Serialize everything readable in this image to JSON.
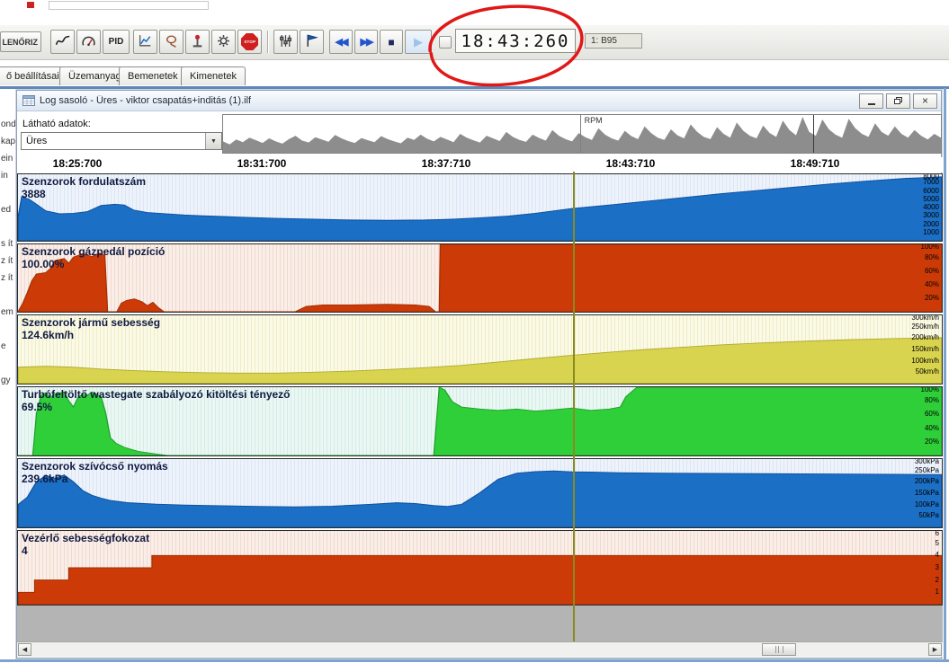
{
  "topbar": {
    "check_button": "LENŐRIZ",
    "pid_button": "PID",
    "stop_sign_label": "STOP",
    "time_display": "18:43:260",
    "channel_badge": "1: B95"
  },
  "icons": {
    "close": "×",
    "dropdown_arrow": "▼",
    "scroll_left": "◀",
    "scroll_right": "▶",
    "rewind": "◀◀",
    "fast_forward": "▶▶",
    "stop": "■",
    "play": "▶"
  },
  "tabs": [
    "ő beállításai",
    "Üzemanyag",
    "Bemenetek",
    "Kimenetek"
  ],
  "sidebar_fragments": [
    "ond",
    "kap",
    "ein",
    "in",
    "ed",
    "s ít",
    "z ít",
    "z ít",
    "em",
    "e",
    "gy"
  ],
  "window": {
    "title": "Log sasoló - Üres - viktor csapatás+inditás (1).ilf",
    "visible_data_label": "Látható adatok:",
    "visible_data_value": "Üres",
    "overview_channel": "RPM"
  },
  "timeline": [
    "18:25:700",
    "18:31:700",
    "18:37:710",
    "18:43:710",
    "18:49:710"
  ],
  "cursor": {
    "x_fraction": 0.602
  },
  "overview": {
    "divider_fraction": 0.497,
    "cursor_fraction": 0.822
  },
  "chart_data": [
    {
      "type": "area",
      "title": "Szenzorok fordulatszám",
      "value_label": "3888",
      "color": "#1b6fc4",
      "edge": "#0d4f9e",
      "ylim": [
        0,
        8000
      ],
      "ticks": [
        "8000",
        "7000",
        "6000",
        "5000",
        "4000",
        "3000",
        "2000",
        "1000"
      ],
      "points": [
        [
          0,
          2800
        ],
        [
          0.004,
          5300
        ],
        [
          0.012,
          5000
        ],
        [
          0.02,
          4400
        ],
        [
          0.03,
          3600
        ],
        [
          0.045,
          3250
        ],
        [
          0.06,
          3300
        ],
        [
          0.075,
          3500
        ],
        [
          0.09,
          4250
        ],
        [
          0.105,
          4400
        ],
        [
          0.115,
          4300
        ],
        [
          0.125,
          3700
        ],
        [
          0.14,
          3400
        ],
        [
          0.16,
          3250
        ],
        [
          0.18,
          3100
        ],
        [
          0.2,
          3000
        ],
        [
          0.24,
          2850
        ],
        [
          0.28,
          2700
        ],
        [
          0.32,
          2600
        ],
        [
          0.36,
          2500
        ],
        [
          0.4,
          2460
        ],
        [
          0.44,
          2500
        ],
        [
          0.46,
          2560
        ],
        [
          0.48,
          2650
        ],
        [
          0.5,
          2760
        ],
        [
          0.53,
          2960
        ],
        [
          0.56,
          3300
        ],
        [
          0.6,
          3888
        ],
        [
          0.64,
          4300
        ],
        [
          0.68,
          4750
        ],
        [
          0.72,
          5200
        ],
        [
          0.76,
          5650
        ],
        [
          0.8,
          6050
        ],
        [
          0.84,
          6450
        ],
        [
          0.88,
          6850
        ],
        [
          0.92,
          7200
        ],
        [
          0.96,
          7500
        ],
        [
          1,
          7700
        ]
      ]
    },
    {
      "type": "area",
      "title": "Szenzorok gázpedál pozíció",
      "value_label": "100.00%",
      "color": "#cc3b07",
      "edge": "#a32f04",
      "ylim": [
        0,
        100
      ],
      "ticks": [
        "100%",
        "80%",
        "60%",
        "40%",
        "20%"
      ],
      "points": [
        [
          0,
          0
        ],
        [
          0.005,
          12
        ],
        [
          0.01,
          28
        ],
        [
          0.015,
          46
        ],
        [
          0.02,
          56
        ],
        [
          0.03,
          58
        ],
        [
          0.035,
          64
        ],
        [
          0.04,
          76
        ],
        [
          0.05,
          79
        ],
        [
          0.055,
          72
        ],
        [
          0.06,
          81
        ],
        [
          0.07,
          86
        ],
        [
          0.08,
          82
        ],
        [
          0.088,
          87
        ],
        [
          0.094,
          84
        ],
        [
          0.097,
          0
        ],
        [
          0.107,
          0
        ],
        [
          0.112,
          13
        ],
        [
          0.118,
          17
        ],
        [
          0.126,
          19
        ],
        [
          0.134,
          15
        ],
        [
          0.14,
          9
        ],
        [
          0.146,
          14
        ],
        [
          0.152,
          6
        ],
        [
          0.158,
          0
        ],
        [
          0.3,
          0
        ],
        [
          0.312,
          8
        ],
        [
          0.33,
          10
        ],
        [
          0.36,
          10
        ],
        [
          0.4,
          11
        ],
        [
          0.43,
          10
        ],
        [
          0.445,
          8
        ],
        [
          0.452,
          0
        ],
        [
          0.456,
          0
        ],
        [
          0.457,
          100
        ],
        [
          1,
          100
        ]
      ]
    },
    {
      "type": "area",
      "title": "Szenzorok jármű sebesség",
      "value_label": "124.6km/h",
      "color": "#d9d44f",
      "edge": "#b0aa30",
      "ylim": [
        0,
        300
      ],
      "ticks": [
        "300km/h",
        "250km/h",
        "200km/h",
        "150km/h",
        "100km/h",
        "50km/h"
      ],
      "points": [
        [
          0,
          72
        ],
        [
          0.03,
          76
        ],
        [
          0.06,
          72
        ],
        [
          0.09,
          64
        ],
        [
          0.12,
          58
        ],
        [
          0.16,
          52
        ],
        [
          0.2,
          48
        ],
        [
          0.24,
          46
        ],
        [
          0.28,
          46
        ],
        [
          0.32,
          50
        ],
        [
          0.36,
          55
        ],
        [
          0.4,
          62
        ],
        [
          0.44,
          70
        ],
        [
          0.48,
          80
        ],
        [
          0.52,
          95
        ],
        [
          0.56,
          110
        ],
        [
          0.6,
          124.6
        ],
        [
          0.64,
          138
        ],
        [
          0.68,
          150
        ],
        [
          0.72,
          160
        ],
        [
          0.76,
          170
        ],
        [
          0.8,
          178
        ],
        [
          0.85,
          186
        ],
        [
          0.9,
          193
        ],
        [
          0.95,
          198
        ],
        [
          1,
          202
        ]
      ]
    },
    {
      "type": "area",
      "title": "Turbófeltöltő wastegate szabályozó kitöltési tényező",
      "value_label": "69.5%",
      "color": "#2fcf39",
      "edge": "#1e9e28",
      "ylim": [
        0,
        100
      ],
      "ticks": [
        "100%",
        "80%",
        "60%",
        "40%",
        "20%"
      ],
      "points": [
        [
          0,
          0
        ],
        [
          0.016,
          0
        ],
        [
          0.02,
          62
        ],
        [
          0.025,
          88
        ],
        [
          0.03,
          92
        ],
        [
          0.035,
          85
        ],
        [
          0.04,
          90
        ],
        [
          0.05,
          93
        ],
        [
          0.055,
          80
        ],
        [
          0.06,
          71
        ],
        [
          0.065,
          85
        ],
        [
          0.07,
          90
        ],
        [
          0.075,
          88
        ],
        [
          0.08,
          93
        ],
        [
          0.085,
          90
        ],
        [
          0.09,
          86
        ],
        [
          0.095,
          62
        ],
        [
          0.1,
          26
        ],
        [
          0.106,
          18
        ],
        [
          0.115,
          12
        ],
        [
          0.13,
          6
        ],
        [
          0.15,
          2
        ],
        [
          0.162,
          0
        ],
        [
          0.45,
          0
        ],
        [
          0.456,
          100
        ],
        [
          0.462,
          96
        ],
        [
          0.47,
          79
        ],
        [
          0.48,
          71
        ],
        [
          0.5,
          68
        ],
        [
          0.52,
          66
        ],
        [
          0.54,
          68
        ],
        [
          0.56,
          65
        ],
        [
          0.58,
          67
        ],
        [
          0.6,
          69.5
        ],
        [
          0.62,
          66
        ],
        [
          0.64,
          68
        ],
        [
          0.652,
          71
        ],
        [
          0.658,
          86
        ],
        [
          0.664,
          93
        ],
        [
          0.67,
          100
        ],
        [
          1,
          100
        ]
      ]
    },
    {
      "type": "area",
      "title": "Szenzorok szívócső nyomás",
      "value_label": "239.6kPa",
      "color": "#1b6fc4",
      "edge": "#0d4f9e",
      "ylim": [
        0,
        300
      ],
      "ticks": [
        "300kPa",
        "250kPa",
        "200kPa",
        "150kPa",
        "100kPa",
        "50kPa"
      ],
      "points": [
        [
          0,
          100
        ],
        [
          0.01,
          132
        ],
        [
          0.02,
          200
        ],
        [
          0.03,
          228
        ],
        [
          0.04,
          216
        ],
        [
          0.05,
          230
        ],
        [
          0.06,
          200
        ],
        [
          0.07,
          162
        ],
        [
          0.08,
          141
        ],
        [
          0.09,
          128
        ],
        [
          0.1,
          118
        ],
        [
          0.12,
          108
        ],
        [
          0.15,
          102
        ],
        [
          0.18,
          98
        ],
        [
          0.22,
          95
        ],
        [
          0.26,
          92
        ],
        [
          0.3,
          90
        ],
        [
          0.34,
          93
        ],
        [
          0.38,
          101
        ],
        [
          0.41,
          108
        ],
        [
          0.43,
          105
        ],
        [
          0.45,
          96
        ],
        [
          0.465,
          92
        ],
        [
          0.48,
          101
        ],
        [
          0.5,
          152
        ],
        [
          0.52,
          212
        ],
        [
          0.54,
          238
        ],
        [
          0.56,
          245
        ],
        [
          0.58,
          248
        ],
        [
          0.6,
          244
        ],
        [
          0.62,
          243
        ],
        [
          0.65,
          240
        ],
        [
          0.7,
          238
        ],
        [
          0.75,
          237
        ],
        [
          0.8,
          236
        ],
        [
          0.85,
          235
        ],
        [
          0.9,
          234
        ],
        [
          0.95,
          233
        ],
        [
          1,
          232
        ]
      ]
    },
    {
      "type": "step",
      "title": "Vezérlő sebességfokozat",
      "value_label": "4",
      "color": "#cc3b07",
      "edge": "#a32f04",
      "ylim": [
        0,
        6
      ],
      "ticks": [
        "6",
        "5",
        "4",
        "3",
        "2",
        "1"
      ],
      "points": [
        [
          0,
          1
        ],
        [
          0.018,
          1
        ],
        [
          0.018,
          2
        ],
        [
          0.055,
          2
        ],
        [
          0.055,
          3
        ],
        [
          0.145,
          3
        ],
        [
          0.145,
          4
        ],
        [
          1,
          4
        ]
      ]
    },
    {
      "type": "overview",
      "title": "RPM",
      "values": [
        0.3,
        0.22,
        0.35,
        0.28,
        0.4,
        0.33,
        0.26,
        0.38,
        0.3,
        0.24,
        0.36,
        0.45,
        0.32,
        0.27,
        0.41,
        0.35,
        0.29,
        0.47,
        0.38,
        0.31,
        0.26,
        0.39,
        0.33,
        0.28,
        0.44,
        0.36,
        0.3,
        0.25,
        0.4,
        0.34,
        0.48,
        0.37,
        0.3,
        0.42,
        0.35,
        0.28,
        0.5,
        0.4,
        0.33,
        0.27,
        0.45,
        0.38,
        0.31,
        0.55,
        0.42,
        0.34,
        0.29,
        0.48,
        0.39,
        0.32,
        0.6,
        0.45,
        0.36,
        0.3,
        0.52,
        0.41,
        0.34,
        0.65,
        0.48,
        0.38,
        0.32,
        0.58,
        0.44,
        0.36,
        0.7,
        0.52,
        0.4,
        0.34,
        0.62,
        0.46,
        0.38,
        0.75,
        0.55,
        0.42,
        0.36,
        0.68,
        0.5,
        0.4,
        0.8,
        0.58,
        0.45,
        0.38,
        0.72,
        0.52,
        0.42,
        0.85,
        0.6,
        0.46,
        0.95,
        0.55,
        0.45,
        0.88,
        0.62,
        0.48,
        0.4,
        0.9,
        0.65,
        0.5,
        0.42,
        0.78,
        0.55,
        0.45,
        0.7,
        0.5,
        0.4,
        0.6,
        0.45,
        0.35,
        0.5,
        0.4
      ]
    }
  ]
}
